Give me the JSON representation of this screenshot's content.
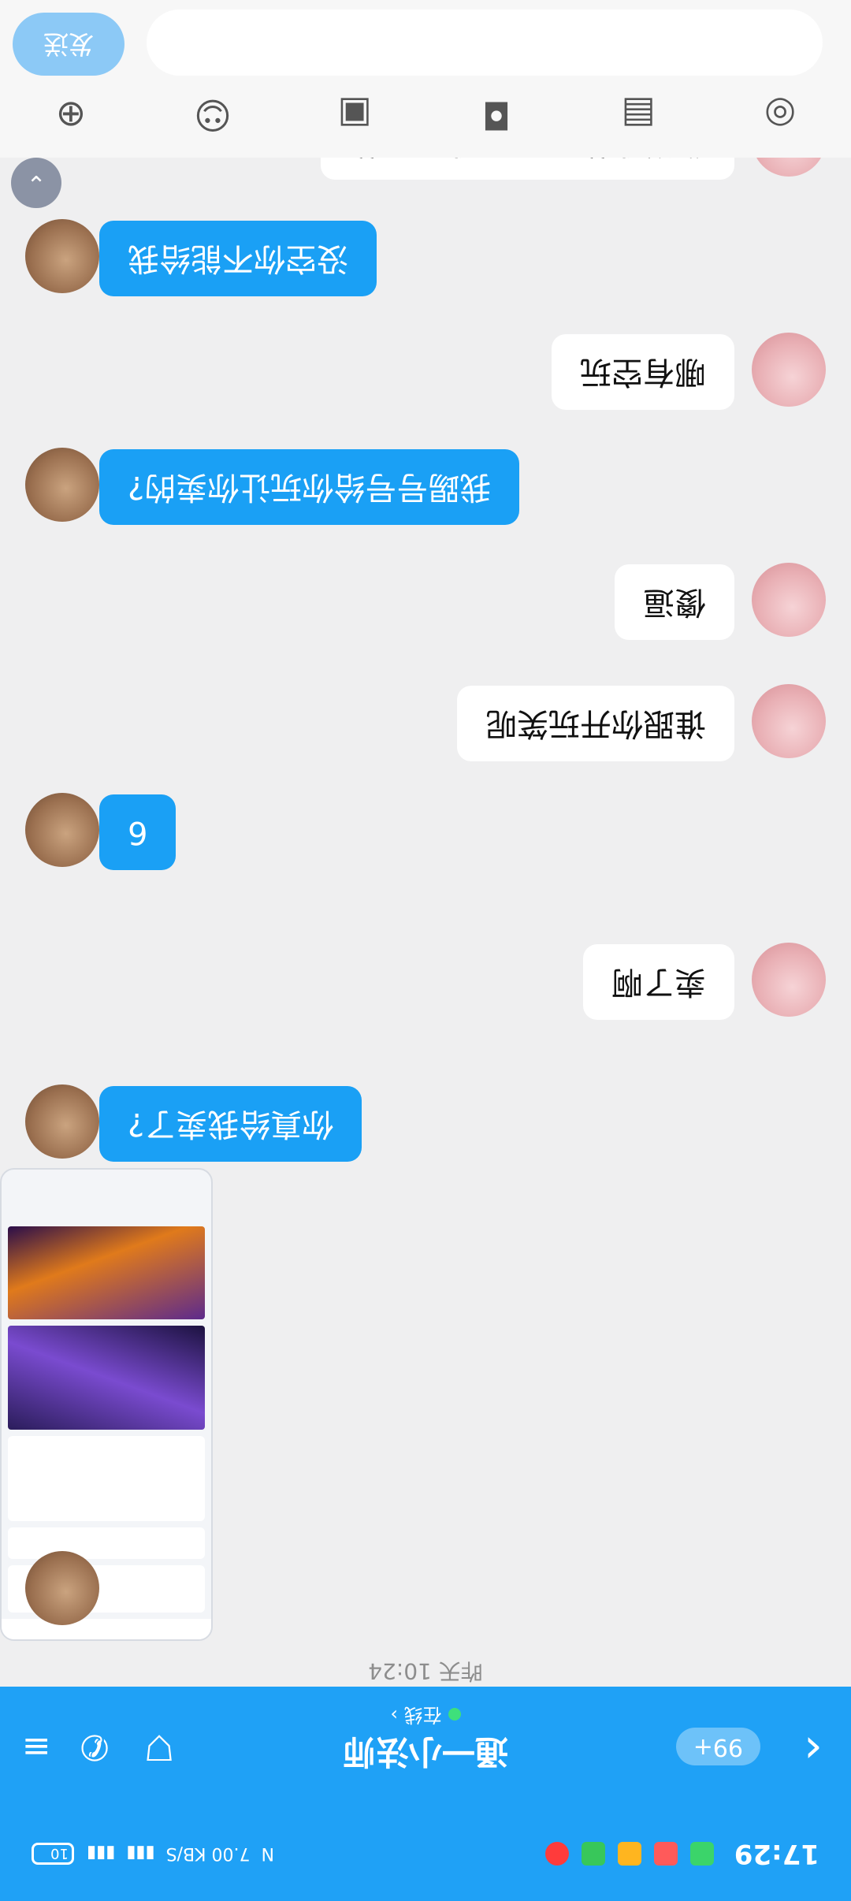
{
  "status_bar": {
    "time": "17:29",
    "speed": "7.00 KB/S",
    "battery": "10"
  },
  "header": {
    "back_icon": "chevron-left-icon",
    "unread_badge": "99+",
    "title": "通一小法师",
    "subtitle": "在线",
    "icons": [
      "shield-icon",
      "phone-icon",
      "menu-icon"
    ]
  },
  "divider": {
    "time": "昨天 10:24"
  },
  "messages": [
    {
      "from": "self",
      "text": "你送我的 又不是我强要的"
    },
    {
      "from": "other",
      "text": "没空你不能给我"
    },
    {
      "from": "self",
      "text": "哪有空玩"
    },
    {
      "from": "other",
      "text": "我踢号号给你玩让你卖的?"
    },
    {
      "from": "self",
      "text": "傻逼"
    },
    {
      "from": "self",
      "text": "谁跟你开玩笑呢"
    },
    {
      "from": "other",
      "text": "6"
    },
    {
      "from": "self",
      "text": "卖了啊"
    },
    {
      "from": "other",
      "text": "你真给我卖了?"
    },
    {
      "from": "other",
      "type": "image",
      "text": ""
    }
  ],
  "input": {
    "send_label": "发送",
    "tools": [
      "voice-icon",
      "image-icon",
      "camera-icon",
      "gallery-icon",
      "emoji-icon",
      "plus-icon"
    ]
  },
  "colors": {
    "accent": "#1fa1f6",
    "bubble_other": "#1aa0f5",
    "bubble_self": "#ffffff",
    "background": "#efeff0"
  }
}
